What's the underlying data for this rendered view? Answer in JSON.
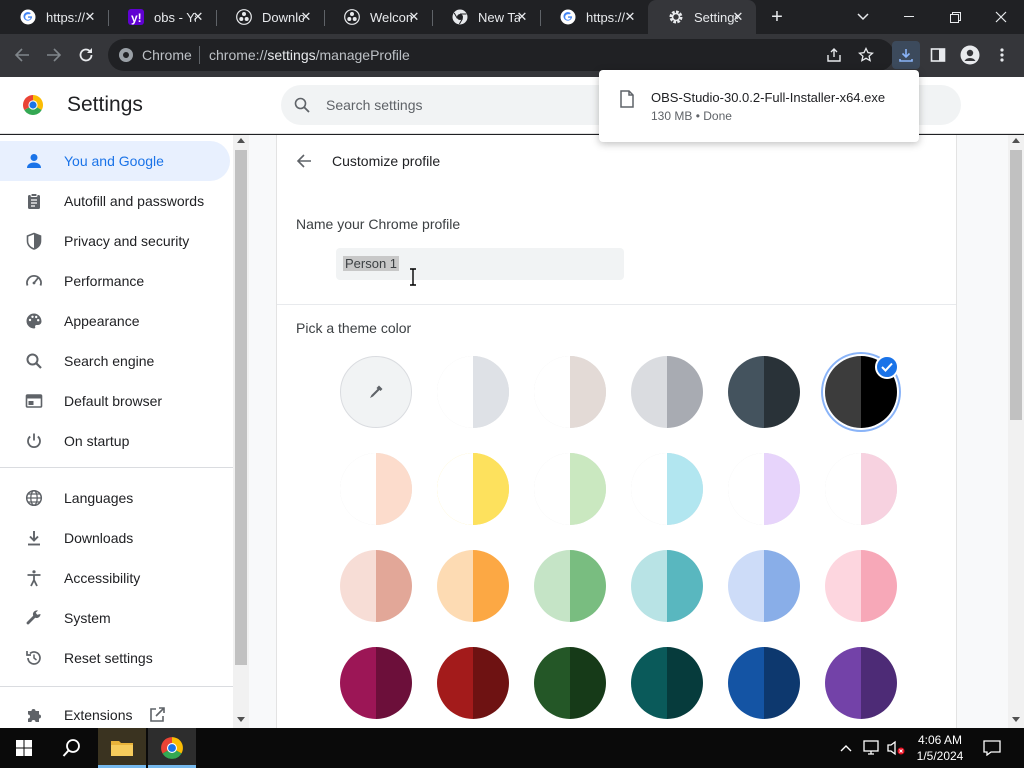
{
  "browser": {
    "tabs": [
      {
        "title": "https://",
        "icon": "google-icon"
      },
      {
        "title": "obs - Ya",
        "icon": "yahoo-icon"
      },
      {
        "title": "Downlo",
        "icon": "obs-icon"
      },
      {
        "title": "Welcom",
        "icon": "obs-icon"
      },
      {
        "title": "New Tal",
        "icon": "chrome-icon"
      },
      {
        "title": "https://",
        "icon": "google-icon"
      },
      {
        "title": "Settings",
        "icon": "gear-icon",
        "active": true
      }
    ],
    "omnibox": {
      "site_label": "Chrome",
      "url_prefix": "chrome://",
      "url_host": "settings",
      "url_path": "/manageProfile"
    }
  },
  "download": {
    "filename": "OBS-Studio-30.0.2-Full-Installer-x64.exe",
    "status": "130 MB • Done"
  },
  "settings": {
    "title": "Settings",
    "search_placeholder": "Search settings",
    "sidebar": {
      "items": [
        {
          "label": "You and Google",
          "icon": "person-icon",
          "active": true
        },
        {
          "label": "Autofill and passwords",
          "icon": "clipboard-icon"
        },
        {
          "label": "Privacy and security",
          "icon": "shield-icon"
        },
        {
          "label": "Performance",
          "icon": "speedometer-icon"
        },
        {
          "label": "Appearance",
          "icon": "palette-icon"
        },
        {
          "label": "Search engine",
          "icon": "search-icon"
        },
        {
          "label": "Default browser",
          "icon": "browser-icon"
        },
        {
          "label": "On startup",
          "icon": "power-icon"
        },
        {
          "label": "Languages",
          "icon": "globe-icon"
        },
        {
          "label": "Downloads",
          "icon": "download-icon"
        },
        {
          "label": "Accessibility",
          "icon": "accessibility-icon"
        },
        {
          "label": "System",
          "icon": "wrench-icon"
        },
        {
          "label": "Reset settings",
          "icon": "reset-icon"
        },
        {
          "label": "Extensions",
          "icon": "puzzle-icon"
        }
      ]
    },
    "page": {
      "title": "Customize profile",
      "name_label": "Name your Chrome profile",
      "name_value": "Person 1",
      "theme_label": "Pick a theme color",
      "themes": [
        {
          "left": "#ffffff",
          "right": "#f1f3f4",
          "type": "custom"
        },
        {
          "left": "#ffffff",
          "right": "#dee1e6"
        },
        {
          "left": "#ffffff",
          "right": "#e3dad6"
        },
        {
          "left": "#dadce0",
          "right": "#a8abb2"
        },
        {
          "left": "#44535e",
          "right": "#293238"
        },
        {
          "left": "#3c3c3c",
          "right": "#000000",
          "selected": true
        },
        {
          "left": "#ffffff",
          "right": "#fcdccc"
        },
        {
          "left": "#ffffff",
          "right": "#fde15d"
        },
        {
          "left": "#ffffff",
          "right": "#cae8c0"
        },
        {
          "left": "#ffffff",
          "right": "#b2e6f0"
        },
        {
          "left": "#ffffff",
          "right": "#e7d4fb"
        },
        {
          "left": "#ffffff",
          "right": "#f7d2e0"
        },
        {
          "left": "#f7ddd6",
          "right": "#e2a798"
        },
        {
          "left": "#fddbb3",
          "right": "#fca844"
        },
        {
          "left": "#c5e4c6",
          "right": "#79bd80"
        },
        {
          "left": "#b8e3e5",
          "right": "#59b7bf"
        },
        {
          "left": "#cddcf8",
          "right": "#89aee8"
        },
        {
          "left": "#fdd6df",
          "right": "#f7a8b8"
        },
        {
          "left": "#9c1656",
          "right": "#6c0f3a"
        },
        {
          "left": "#a31b1b",
          "right": "#6e1212"
        },
        {
          "left": "#245727",
          "right": "#163a18"
        },
        {
          "left": "#0a5a5a",
          "right": "#063b3c"
        },
        {
          "left": "#1454a4",
          "right": "#0d386e"
        },
        {
          "left": "#7342a8",
          "right": "#4d2b76"
        }
      ]
    }
  },
  "taskbar": {
    "time": "4:06 AM",
    "date": "1/5/2024"
  },
  "colors": {
    "accent": "#1a73e8",
    "selected_ring": "#8ab4f8"
  }
}
